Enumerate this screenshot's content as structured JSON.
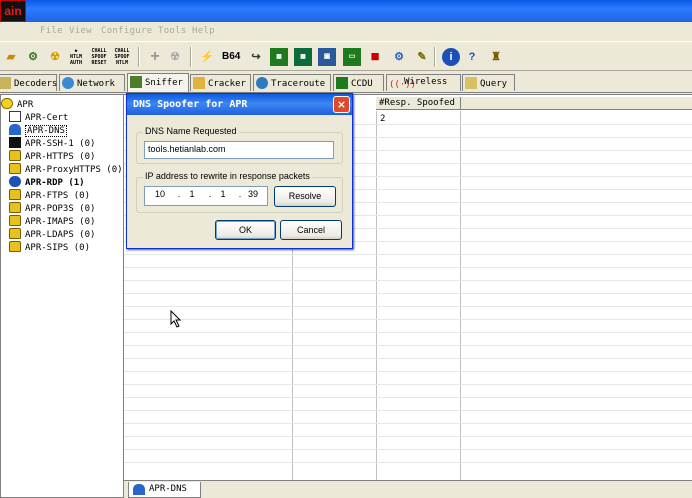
{
  "app": {
    "icon_text": "ain"
  },
  "menu": [
    "File",
    "View",
    "Configure",
    "Tools",
    "Help"
  ],
  "toolbar": {
    "icons": [
      "open-icon",
      "network-card-icon",
      "sniffer-icon",
      "ntlm-auth-icon",
      "challenge-spoof-reset-icon",
      "challenge-spoof-ntlm-icon",
      "add-icon",
      "remove-icon",
      "decoder-icon",
      "base64-icon",
      "traceroute-icon",
      "hash-calculator-icon",
      "wireless-icon",
      "cisco-icon",
      "router-icon",
      "lsa-icon",
      "cached-password-icon",
      "help-icon",
      "about-icon",
      "oxid-icon"
    ],
    "base64_label": "B64"
  },
  "tabs": [
    {
      "label": "Decoders",
      "icon": "decoder-icon"
    },
    {
      "label": "Network",
      "icon": "network-icon"
    },
    {
      "label": "Sniffer",
      "icon": "sniffer-icon"
    },
    {
      "label": "Cracker",
      "icon": "cracker-icon"
    },
    {
      "label": "Traceroute",
      "icon": "traceroute-icon"
    },
    {
      "label": "CCDU",
      "icon": "ccdu-icon"
    },
    {
      "label": "Wireless",
      "icon": "wireless-icon"
    },
    {
      "label": "Query",
      "icon": "query-icon"
    }
  ],
  "tree": {
    "root": "APR",
    "items": [
      {
        "label": "APR-Cert",
        "icon": "certificate-icon",
        "bold": false
      },
      {
        "label": "APR-DNS",
        "icon": "dns-icon",
        "bold": false,
        "selected": true
      },
      {
        "label": "APR-SSH-1  (0)",
        "icon": "terminal-icon",
        "bold": false
      },
      {
        "label": "APR-HTTPS  (0)",
        "icon": "lock-icon",
        "bold": false
      },
      {
        "label": "APR-ProxyHTTPS  (0)",
        "icon": "lock-icon",
        "bold": false
      },
      {
        "label": "APR-RDP  (1)",
        "icon": "rdp-icon",
        "bold": true
      },
      {
        "label": "APR-FTPS  (0)",
        "icon": "lock-icon",
        "bold": false
      },
      {
        "label": "APR-POP3S  (0)",
        "icon": "lock-icon",
        "bold": false
      },
      {
        "label": "APR-IMAPS  (0)",
        "icon": "lock-icon",
        "bold": false
      },
      {
        "label": "APR-LDAPS  (0)",
        "icon": "lock-icon",
        "bold": false
      },
      {
        "label": "APR-SIPS  (0)",
        "icon": "lock-icon",
        "bold": false
      }
    ]
  },
  "grid": {
    "columns": [
      "#Resp. Spoofed"
    ],
    "rows": [
      [
        "2"
      ]
    ]
  },
  "status": {
    "tab_label": "APR-DNS"
  },
  "dialog": {
    "title": "DNS Spoofer for APR",
    "close": "×",
    "dns_group_label": "DNS Name Requested",
    "dns_value": "tools.hetianlab.com",
    "ip_group_label": "IP address to rewrite in response packets",
    "ip_octets": [
      "10",
      "1",
      "1",
      "39"
    ],
    "resolve_label": "Resolve",
    "ok_label": "OK",
    "cancel_label": "Cancel"
  }
}
